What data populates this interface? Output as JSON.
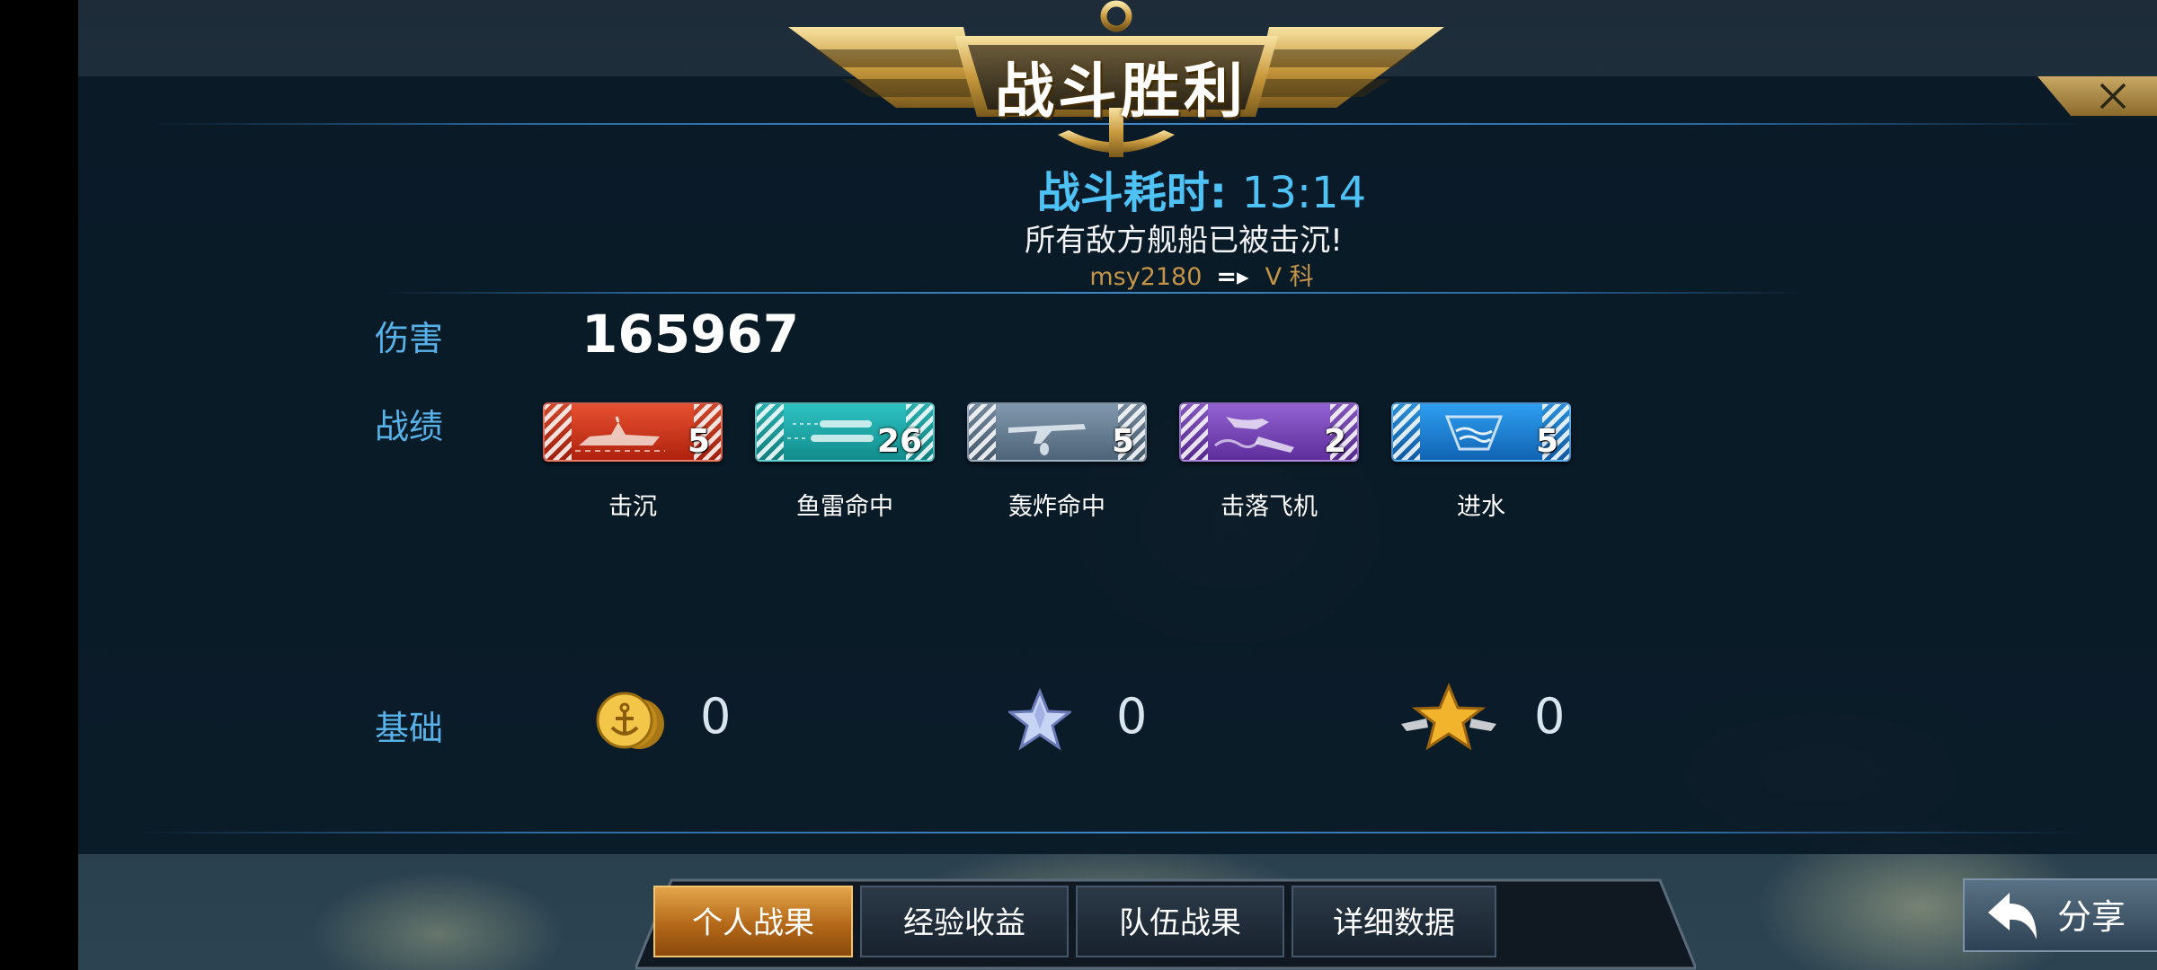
{
  "header": {
    "title": "战斗胜利",
    "duration_label": "战斗耗时:",
    "duration_value": "13:14",
    "subtitle": "所有敌方舰船已被击沉!",
    "player_name": "msy2180",
    "player_rank": "V 科"
  },
  "damage": {
    "label": "伤害",
    "value": "165967"
  },
  "record": {
    "label": "战绩",
    "items": [
      {
        "label": "击沉",
        "count": "5",
        "icon": "ship-sinking-icon",
        "color": "#d8361c"
      },
      {
        "label": "鱼雷命中",
        "count": "26",
        "icon": "torpedo-icon",
        "color": "#22a8a8"
      },
      {
        "label": "轰炸命中",
        "count": "5",
        "icon": "bomber-plane-icon",
        "color": "#6a7f96"
      },
      {
        "label": "击落飞机",
        "count": "2",
        "icon": "plane-shot-down-icon",
        "color": "#7a4ab8"
      },
      {
        "label": "进水",
        "count": "5",
        "icon": "flooding-icon",
        "color": "#1b86d8"
      }
    ]
  },
  "base": {
    "label": "基础",
    "items": [
      {
        "icon": "gold-coin-icon",
        "value": "0"
      },
      {
        "icon": "silver-star-icon",
        "value": "0"
      },
      {
        "icon": "gold-star-icon",
        "value": "0"
      }
    ]
  },
  "tabs": [
    {
      "label": "个人战果",
      "active": true
    },
    {
      "label": "经验收益",
      "active": false
    },
    {
      "label": "队伍战果",
      "active": false
    },
    {
      "label": "详细数据",
      "active": false
    }
  ],
  "share_label": "分享"
}
